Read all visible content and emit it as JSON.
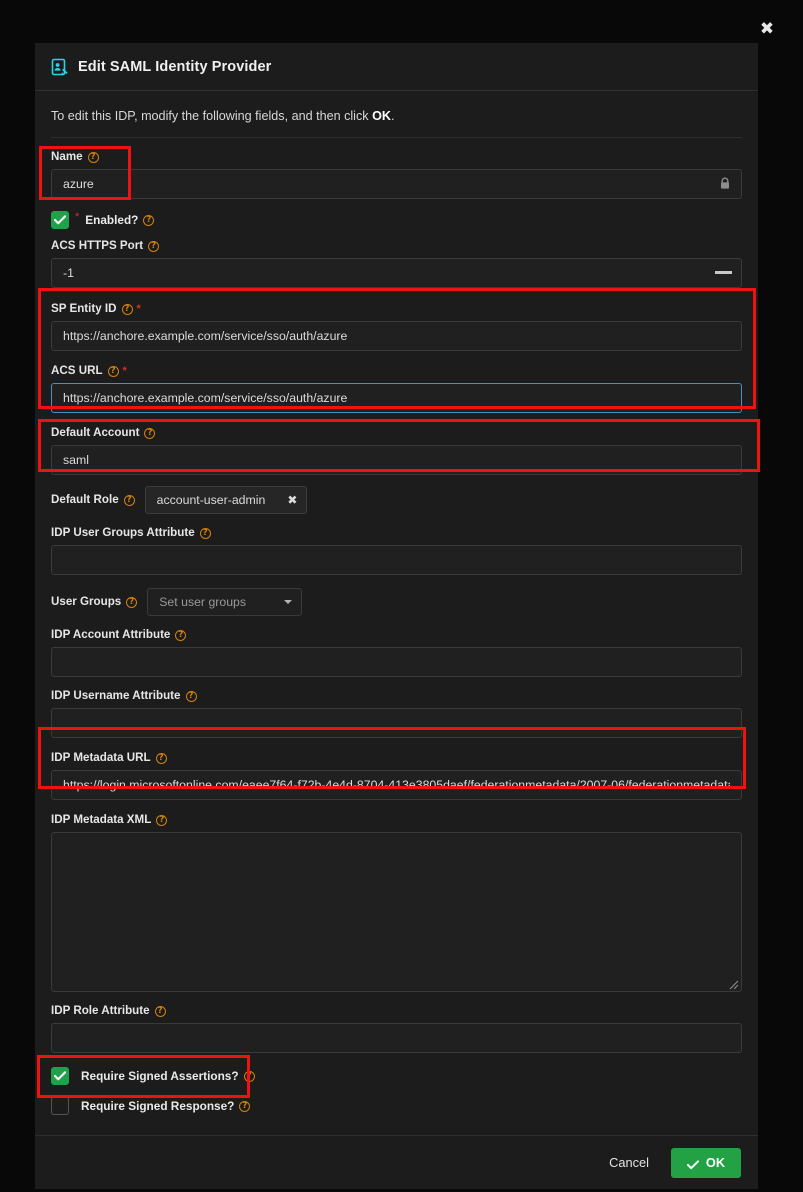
{
  "window": {
    "close_icon": "close-icon"
  },
  "dialog": {
    "icon": "edit-identity-card-icon",
    "title": "Edit SAML Identity Provider",
    "intro_prefix": "To edit this IDP, modify the following fields, and then click ",
    "intro_bold": "OK",
    "intro_suffix": "."
  },
  "fields": {
    "name": {
      "label": "Name",
      "value": "azure",
      "lock_icon": "lock-icon",
      "help_icon": "help-circle-icon"
    },
    "enabled": {
      "label": "Enabled?",
      "checked": true,
      "required_marker": "*"
    },
    "acs_https_port": {
      "label": "ACS HTTPS Port",
      "value": "-1",
      "stepper_icon": "minus-icon"
    },
    "sp_entity_id": {
      "label": "SP Entity ID",
      "required_marker": "*",
      "value": "https://anchore.example.com/service/sso/auth/azure"
    },
    "acs_url": {
      "label": "ACS URL",
      "required_marker": "*",
      "value": "https://anchore.example.com/service/sso/auth/azure",
      "focused": true
    },
    "default_account": {
      "label": "Default Account",
      "value": "saml"
    },
    "default_role": {
      "label": "Default Role",
      "value": "account-user-admin",
      "remove_icon": "close-x-icon"
    },
    "idp_user_groups_attribute": {
      "label": "IDP User Groups Attribute",
      "value": ""
    },
    "user_groups": {
      "label": "User Groups",
      "placeholder": "Set user groups",
      "caret_icon": "chevron-down-icon"
    },
    "idp_account_attribute": {
      "label": "IDP Account Attribute",
      "value": ""
    },
    "idp_username_attribute": {
      "label": "IDP Username Attribute",
      "value": ""
    },
    "idp_metadata_url": {
      "label": "IDP Metadata URL",
      "value": "https://login.microsoftonline.com/eaee7f64-f72b-4e4d-8704-413e3805daef/federationmetadata/2007-06/federationmetadata.xml?appid"
    },
    "idp_metadata_xml": {
      "label": "IDP Metadata XML",
      "value": "",
      "resize_icon": "resize-grip-icon"
    },
    "idp_role_attribute": {
      "label": "IDP Role Attribute",
      "value": ""
    },
    "require_signed_assertions": {
      "label": "Require Signed Assertions?",
      "checked": true
    },
    "require_signed_response": {
      "label": "Require Signed Response?",
      "checked": false
    }
  },
  "footer": {
    "cancel_label": "Cancel",
    "ok_label": "OK",
    "ok_icon": "check-icon"
  },
  "colors": {
    "accent_green": "#22a245",
    "annotation_red": "#ef1212",
    "help_orange": "#d4820a",
    "focus_blue": "#4a8fc0",
    "dialog_bg": "#1c1c1c"
  }
}
